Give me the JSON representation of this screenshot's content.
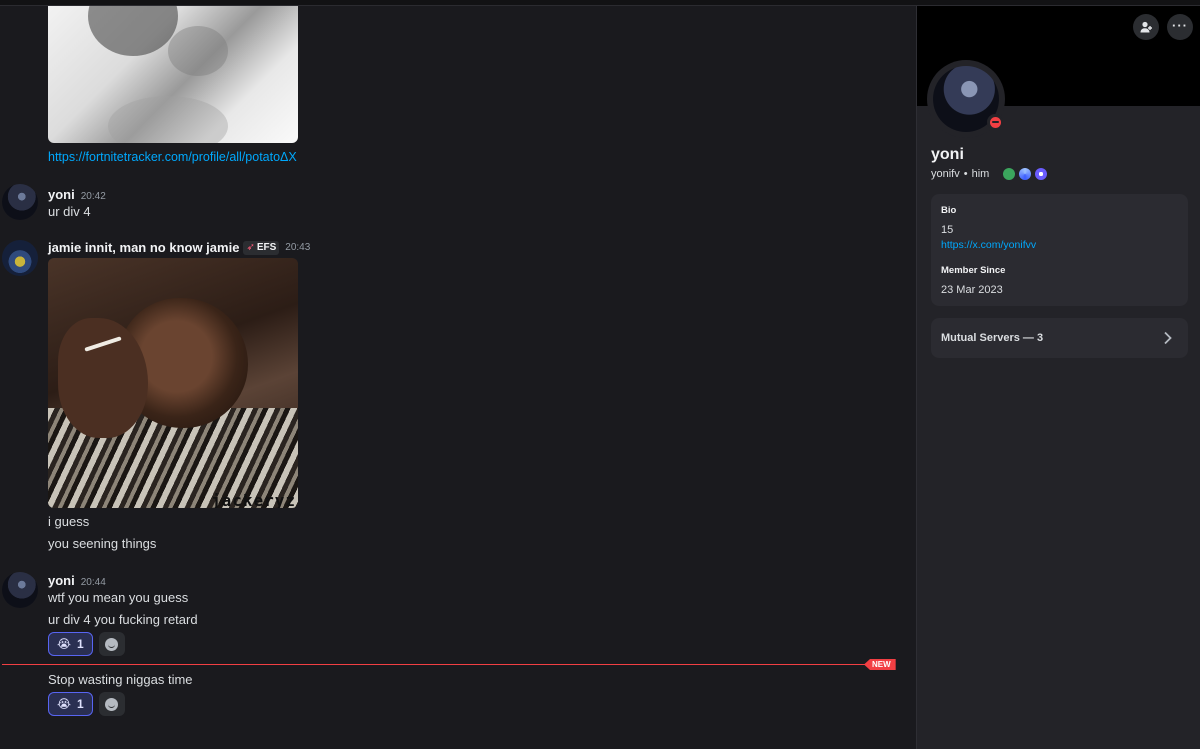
{
  "chat": {
    "link_prev": "https://fortnitetracker.com/profile/all/potatoΔX",
    "messages": [
      {
        "author": "yoni",
        "time": "20:42",
        "lines": [
          "ur div 4"
        ]
      },
      {
        "author": "jamie innit, man no know jamie",
        "tag": "EFS",
        "time": "20:43",
        "image_watermark": "jackeryz",
        "lines": [
          "i guess",
          "you seening things"
        ]
      },
      {
        "author": "yoni",
        "time": "20:44",
        "lines": [
          "wtf you mean you guess",
          "ur div 4 you fucking retard"
        ],
        "reaction": {
          "emoji": "😭",
          "count": "1"
        }
      }
    ],
    "new_label": "NEW",
    "last_message": {
      "text": "Stop wasting niggas time",
      "reaction": {
        "emoji": "😭",
        "count": "1"
      }
    }
  },
  "profile": {
    "display_name": "yoni",
    "username": "yonifv",
    "pronouns": "him",
    "separator": "•",
    "bio_label": "Bio",
    "bio_text": "15",
    "bio_link": "https://x.com/yonifvv",
    "member_since_label": "Member Since",
    "member_since": "23 Mar 2023",
    "mutual_servers": "Mutual Servers — 3",
    "accent_color": "#5865f2",
    "status_color": "#f23f43"
  }
}
